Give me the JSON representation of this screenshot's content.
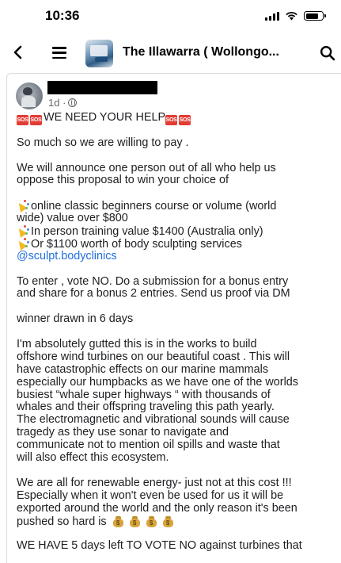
{
  "status_bar": {
    "time": "10:36"
  },
  "header": {
    "group_name": "The Illawarra ( Wollongo..."
  },
  "post": {
    "timestamp": "1d ·",
    "title_text": "WE NEED YOUR HELP",
    "lines": {
      "l2": "So much so we are  willing to pay .",
      "l3a": "We will  announce one person out of all who help us",
      "l3b": "oppose this proposal to win your choice of",
      "l4a": "online classic beginners course or volume (world",
      "l4b": "wide) value over $800",
      "l4c": "In person training value $1400 (Australia only)",
      "l4d": "Or $1100 worth of body sculpting services",
      "l4e": "@sculpt.bodyclinics",
      "l5a": "To enter , vote NO.  Do a submission for a bonus entry",
      "l5b": "and share for a bonus 2 entries. Send us proof via DM",
      "l6": "winner drawn in 6 days",
      "l7a": "I'm absolutely gutted this is in the works to build",
      "l7b": "offshore wind turbines on our beautiful coast .  This will",
      "l7c": "have catastrophic effects on our marine mammals",
      "l7d": "especially our humpbacks as we have one of the worlds",
      "l7e": "busiest “whale super highways “ with thousands of",
      "l7f": "whales and their offspring traveling this path yearly.",
      "l7g": "The electromagnetic and vibrational sounds will cause",
      "l7h": "tragedy as they use sonar to navigate and",
      "l7i": "communicate not to mention oil spills and waste that",
      "l7j": "will also effect this ecosystem.",
      "l8a": "We are all for renewable energy- just not at this cost !!!",
      "l8b": "Especially when it won't even be used for us it will be",
      "l8c": "exported around the world and the only reason it's been",
      "l8d": "pushed so hard is",
      "l9": "WE HAVE 5 days left TO VOTE NO against turbines that"
    },
    "sos_label": "SOS"
  },
  "colors": {
    "sos": "#e23c33",
    "mention": "#216fdb",
    "meta": "#65676b"
  },
  "icons": [
    "back-arrow-icon",
    "hamburger-menu-icon",
    "search-icon",
    "globe-icon",
    "sos-icon",
    "party-popper-icon",
    "money-bag-icon"
  ]
}
